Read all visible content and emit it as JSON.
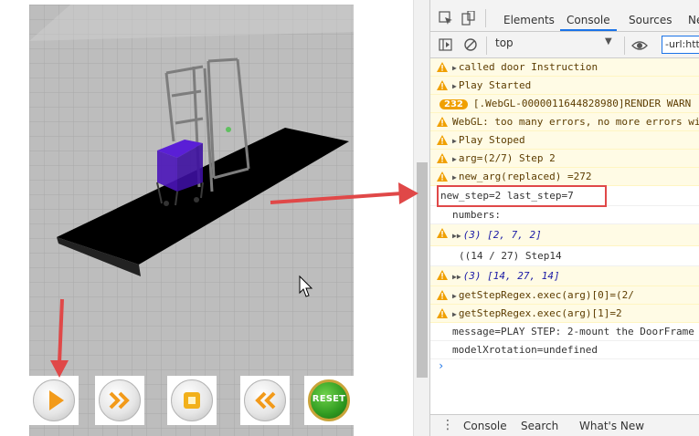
{
  "game": {
    "controls": {
      "play": "play-button",
      "fast_forward": "fast-forward-button",
      "stop": "stop-button",
      "rewind": "rewind-button",
      "reset_label": "RESET"
    }
  },
  "devtools": {
    "tabs": [
      "Elements",
      "Console",
      "Sources",
      "Ne"
    ],
    "active_tab": "Console",
    "context": "top",
    "filter_value": "-url:htt",
    "colors": {
      "accent": "#1a73e8",
      "warning_bg": "#fffbe5",
      "annotation": "#e04848"
    },
    "logs": [
      {
        "level": "warning",
        "text": "called door Instruction"
      },
      {
        "level": "warning",
        "text": "Play Started"
      },
      {
        "level": "warning",
        "badge": "232",
        "text": "[.WebGL-0000011644828980]RENDER WARN"
      },
      {
        "level": "warning",
        "text": "WebGL: too many errors, no more errors wi"
      },
      {
        "level": "warning",
        "text": "Play Stoped"
      },
      {
        "level": "warning",
        "text": "arg=(2/7) Step 2"
      },
      {
        "level": "warning",
        "text": "new_arg(replaced) =272"
      },
      {
        "level": "info",
        "text": "new_step=2 last_step=7"
      },
      {
        "level": "info",
        "text": "numbers:"
      },
      {
        "level": "warning",
        "text": "(3) [2, 7, 2]"
      },
      {
        "level": "info",
        "text": "((14 / 27) Step14"
      },
      {
        "level": "warning",
        "text": "(3) [14, 27, 14]"
      },
      {
        "level": "warning",
        "text": "getStepRegex.exec(arg)[0]=(2/"
      },
      {
        "level": "warning",
        "text": "getStepRegex.exec(arg)[1]=2"
      },
      {
        "level": "info",
        "text": "message=PLAY STEP: 2-mount the DoorFrame"
      },
      {
        "level": "info",
        "text": "modelXrotation=undefined"
      }
    ],
    "drawer_tabs": [
      "Console",
      "Search",
      "What's New"
    ]
  }
}
